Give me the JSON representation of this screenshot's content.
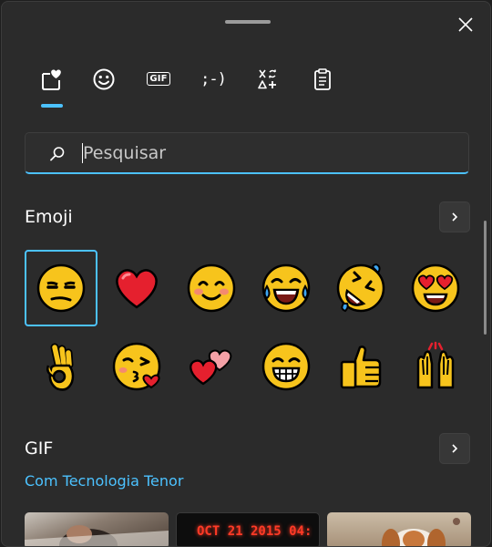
{
  "window": {
    "close_label": "Close"
  },
  "tabs": [
    {
      "name": "emoji",
      "icon": "heart-sticky-icon",
      "active": true
    },
    {
      "name": "kaomoji-face",
      "icon": "smiley-icon"
    },
    {
      "name": "gif",
      "label": "GIF"
    },
    {
      "name": "kaomoji",
      "label": ";-)"
    },
    {
      "name": "symbols",
      "icon": "symbols-icon"
    },
    {
      "name": "clipboard",
      "icon": "clipboard-icon"
    }
  ],
  "search": {
    "placeholder": "Pesquisar",
    "value": ""
  },
  "emoji_section": {
    "title": "Emoji",
    "items": [
      {
        "name": "unamused-face",
        "selected": true
      },
      {
        "name": "red-heart"
      },
      {
        "name": "smiling-face-with-smiling-eyes"
      },
      {
        "name": "face-with-tears-of-joy"
      },
      {
        "name": "rolling-on-the-floor-laughing"
      },
      {
        "name": "smiling-face-with-heart-eyes"
      },
      {
        "name": "ok-hand"
      },
      {
        "name": "face-blowing-a-kiss"
      },
      {
        "name": "two-hearts"
      },
      {
        "name": "beaming-face"
      },
      {
        "name": "thumbs-up"
      },
      {
        "name": "raising-hands"
      }
    ]
  },
  "gif_section": {
    "title": "GIF",
    "provider": "Com Tecnologia Tenor",
    "thumbnails": [
      {
        "name": "gif-thumb-sleeping-man"
      },
      {
        "name": "gif-thumb-clock-display",
        "text": "OCT 21 2015 04:"
      },
      {
        "name": "gif-thumb-puppy"
      }
    ]
  },
  "colors": {
    "accent": "#4cc2ff",
    "panel_bg": "#2b2b2b",
    "emoji_yellow": "#f7c41c",
    "emoji_red": "#e5202e"
  }
}
